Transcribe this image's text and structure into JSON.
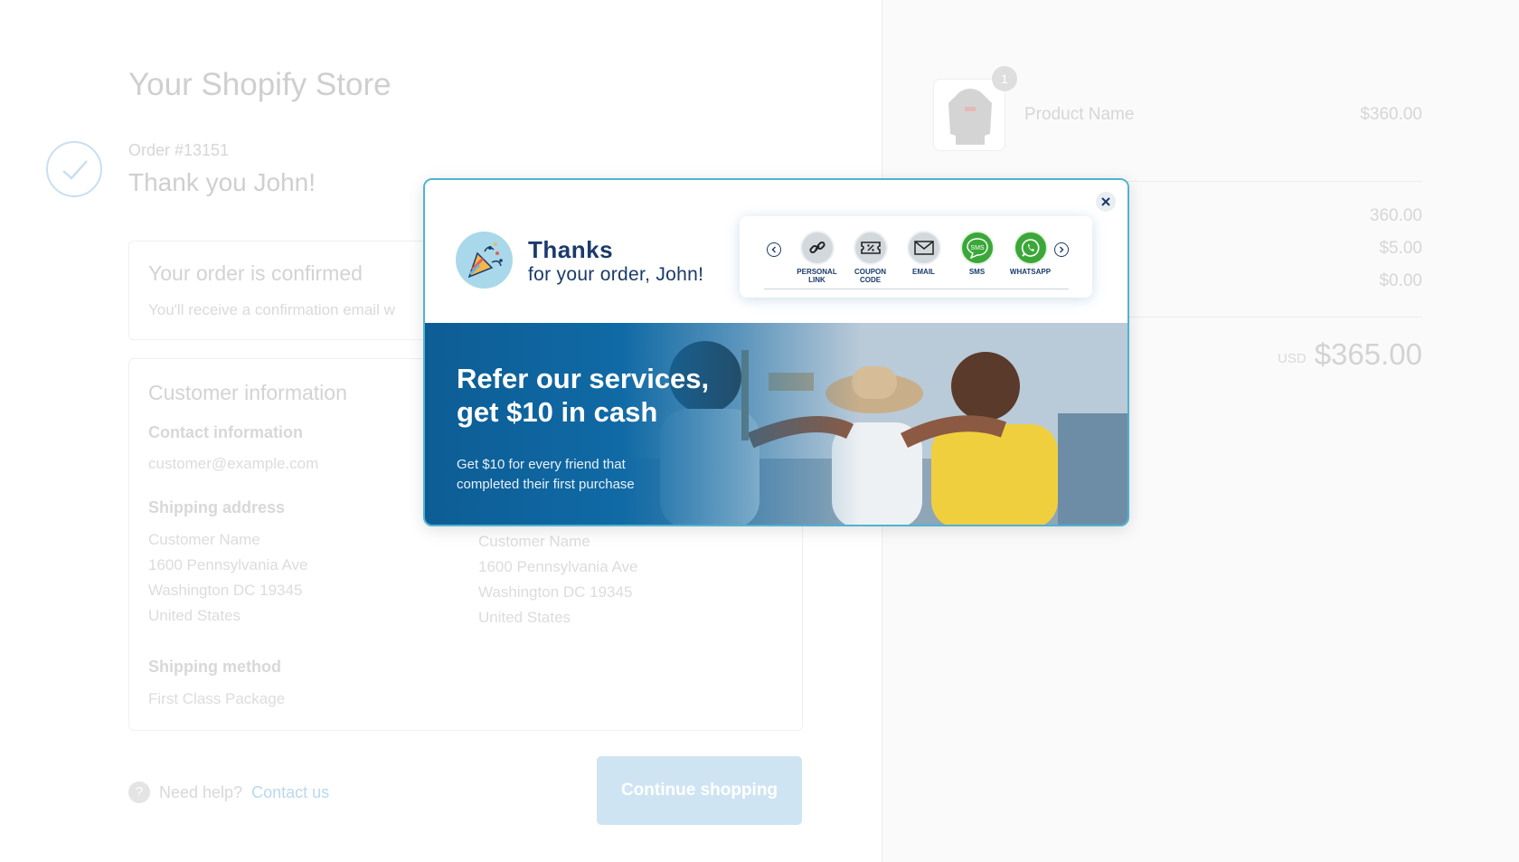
{
  "store": {
    "title": "Your Shopify Store",
    "order_number": "Order #13151",
    "thank_you": "Thank you John!"
  },
  "confirmation": {
    "title": "Your order is confirmed",
    "subtitle": "You'll receive a confirmation email w"
  },
  "customer_info": {
    "title": "Customer information",
    "contact_label": "Contact information",
    "contact_email": "customer@example.com",
    "shipping_label": "Shipping address",
    "shipping_lines": [
      "Customer Name",
      "1600 Pennsylvania Ave",
      "Washington DC 19345",
      "United States"
    ],
    "billing_lines": [
      "Customer Name",
      "1600 Pennsylvania Ave",
      "Washington DC 19345",
      "United States"
    ],
    "method_label": "Shipping method",
    "method_value": "First Class Package"
  },
  "footer": {
    "help_text": "Need help?",
    "help_icon": "?",
    "contact_link": "Contact us",
    "continue_label": "Continue shopping"
  },
  "summary": {
    "item_count": "1",
    "product_name": "Product Name",
    "product_price": "$360.00",
    "subtotal": "360.00",
    "shipping": "$5.00",
    "taxes": "$0.00",
    "currency": "USD",
    "total": "$365.00"
  },
  "modal": {
    "thanks_title": "Thanks",
    "thanks_sub": "for your order, John!",
    "share_options": [
      {
        "label": "PERSONAL LINK",
        "icon": "link-icon",
        "active": false
      },
      {
        "label": "COUPON CODE",
        "icon": "coupon-icon",
        "active": false
      },
      {
        "label": "EMAIL",
        "icon": "envelope-icon",
        "active": false
      },
      {
        "label": "SMS",
        "icon": "sms-icon",
        "icon_text": "SMS",
        "active": true
      },
      {
        "label": "WHATSAPP",
        "icon": "whatsapp-icon",
        "active": true
      }
    ],
    "banner_title_1": "Refer our services,",
    "banner_title_2": "get $10 in cash",
    "banner_sub": "Get $10 for every friend that completed their first purchase"
  },
  "colors": {
    "brand_dark": "#1b3a6b",
    "accent_blue": "#106aa5",
    "share_green": "#3ca739",
    "modal_border": "#4fb3d1"
  }
}
